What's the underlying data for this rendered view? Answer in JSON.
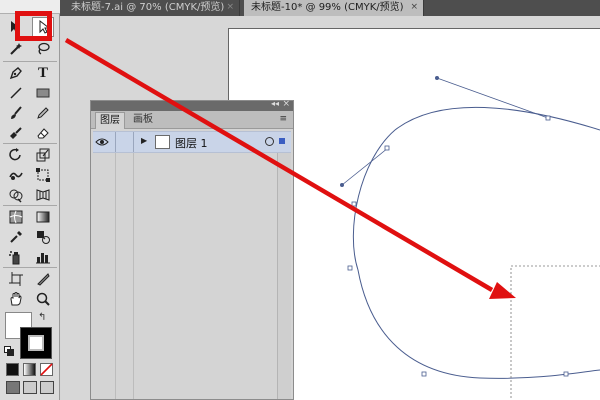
{
  "document_tabs": [
    {
      "label": "未标题-7.ai @ 70% (CMYK/预览)",
      "close": "×",
      "active": false
    },
    {
      "label": "未标题-10* @ 99% (CMYK/预览)",
      "close": "×",
      "active": true
    }
  ],
  "layers_panel": {
    "tabs": [
      {
        "label": "图层",
        "active": true
      },
      {
        "label": "画板",
        "active": false
      }
    ],
    "collapse_glyph": "◂◂",
    "close_glyph": "×",
    "menu_glyph": "≡",
    "layer": {
      "name": "图层 1",
      "expand_glyph": "▶",
      "visible": true,
      "color": "#3b5ec2"
    }
  },
  "toolbar": {
    "type_tool_glyph": "T",
    "selected_tool": "selection-tool"
  },
  "colors": {
    "highlight": "#e01010",
    "path": "#4a5d8f",
    "layer_selected": "#c9d4e8"
  }
}
